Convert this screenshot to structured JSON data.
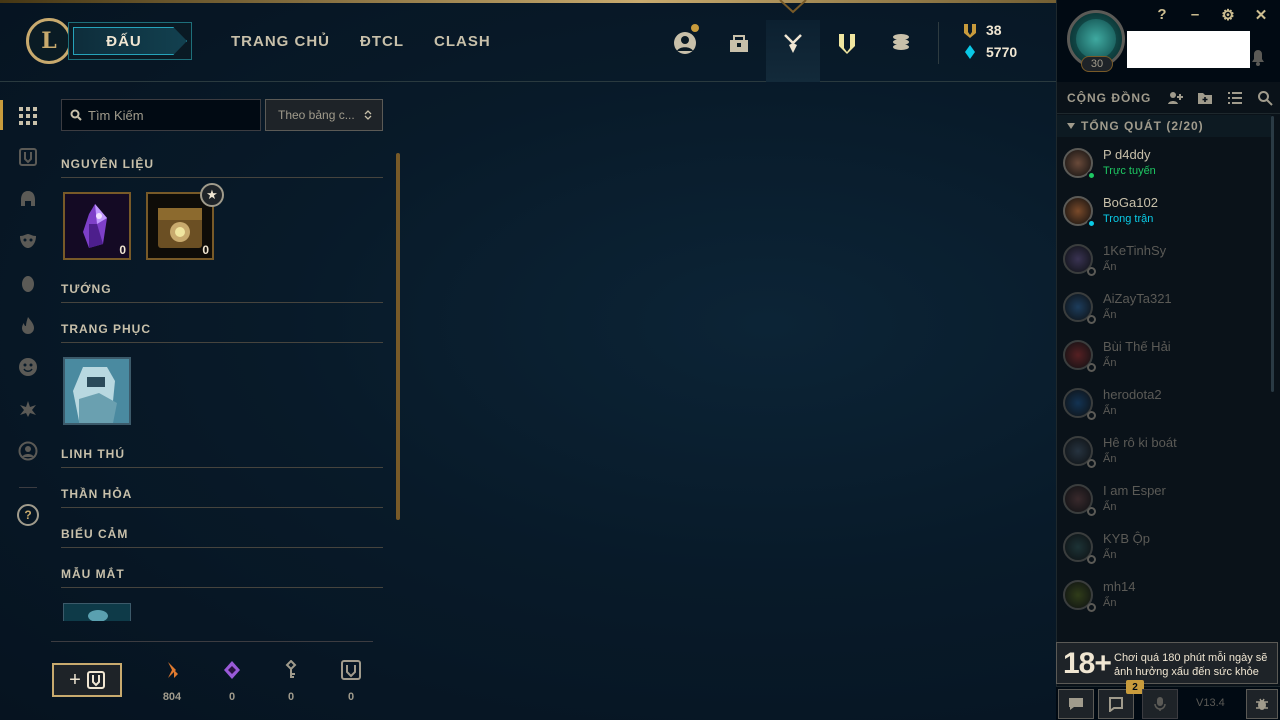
{
  "header": {
    "logo_letter": "L",
    "play_label": "ĐẤU",
    "nav": [
      "TRANG CHỦ",
      "ĐTCL",
      "CLASH"
    ],
    "currency": {
      "rp": "38",
      "be": "5770"
    }
  },
  "profile": {
    "level": "30"
  },
  "window": {
    "help": "?",
    "minimize": "–",
    "settings": "⚙",
    "close": "✕"
  },
  "inventory": {
    "search_placeholder": "Tìm Kiếm",
    "sort_label": "Theo bảng c...",
    "categories": {
      "materials": "NGUYÊN LIỆU",
      "champions": "TƯỚNG",
      "skins": "TRANG PHỤC",
      "companions": "LINH THÚ",
      "wards": "THẦN HỎA",
      "emotes": "BIỂU CẢM",
      "eyes": "MẪU MẮT"
    },
    "materials_items": [
      {
        "name": "mythic-essence",
        "count": "0"
      },
      {
        "name": "chest",
        "count": "0"
      }
    ]
  },
  "resources": [
    {
      "name": "orange-essence",
      "value": "804"
    },
    {
      "name": "mythic-essence",
      "value": "0"
    },
    {
      "name": "key-fragment",
      "value": "0"
    },
    {
      "name": "key",
      "value": "0"
    }
  ],
  "social": {
    "title": "CỘNG ĐỒNG",
    "group": "TỔNG QUÁT (2/20)",
    "friends": [
      {
        "name": "P d4ddy",
        "status": "Trực tuyến",
        "state": "online"
      },
      {
        "name": "BoGa102",
        "status": "Trong trận",
        "state": "ingame"
      },
      {
        "name": "1KeTinhSy",
        "status": "Ẩn",
        "state": "away"
      },
      {
        "name": "AiZayTa321",
        "status": "Ẩn",
        "state": "away"
      },
      {
        "name": "Bùi Thế Hải",
        "status": "Ẩn",
        "state": "away"
      },
      {
        "name": "herodota2",
        "status": "Ẩn",
        "state": "away"
      },
      {
        "name": "Hê rô ki boát",
        "status": "Ẩn",
        "state": "away"
      },
      {
        "name": "I am Esper",
        "status": "Ẩn",
        "state": "away"
      },
      {
        "name": "KYB Ộp",
        "status": "Ẩn",
        "state": "away"
      },
      {
        "name": "mh14",
        "status": "Ẩn",
        "state": "away"
      }
    ],
    "age_rating": "18+",
    "age_warning": "Chơi quá 180 phút mỗi ngày sẽ ảnh hưởng xấu đến sức khỏe",
    "missions_badge": "2",
    "version": "V13.4"
  },
  "colors": {
    "gold": "#c8aa6e",
    "online": "#1ec863",
    "ingame": "#0acbe6",
    "away": "#5b5a56"
  }
}
